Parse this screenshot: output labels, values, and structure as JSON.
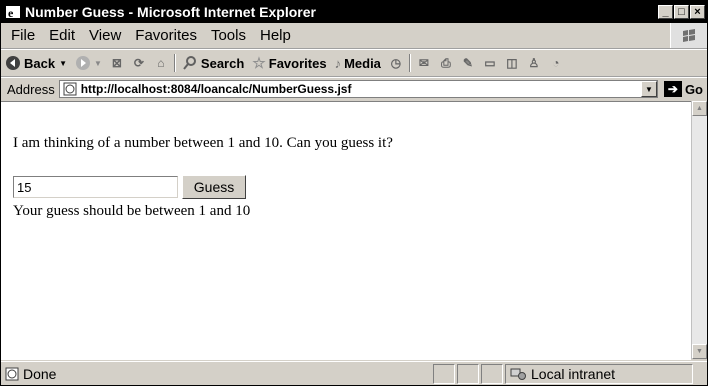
{
  "window": {
    "title": "Number Guess - Microsoft Internet Explorer"
  },
  "menu": [
    "File",
    "Edit",
    "View",
    "Favorites",
    "Tools",
    "Help"
  ],
  "toolbar": {
    "back": "Back",
    "search": "Search",
    "favorites": "Favorites",
    "media": "Media"
  },
  "address": {
    "label": "Address",
    "url": "http://localhost:8084/loancalc/NumberGuess.jsf",
    "go": "Go"
  },
  "page": {
    "prompt": "I am thinking of a number between 1 and 10. Can you guess it?",
    "input_value": "15",
    "button_label": "Guess",
    "message": "Your guess should be between 1 and 10"
  },
  "status": {
    "text": "Done",
    "zone": "Local intranet"
  }
}
